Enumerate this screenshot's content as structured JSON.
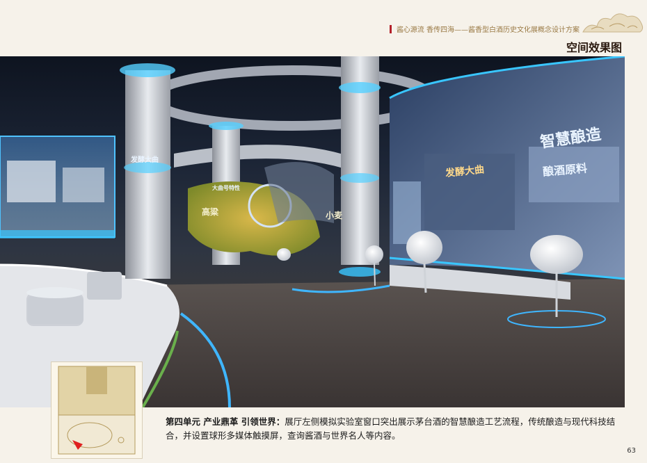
{
  "header": {
    "subtitle": "酱心源流 香传四海——酱香型白酒历史文化展概念设计方案",
    "section_title": "空间效果图"
  },
  "hero": {
    "signs": {
      "smart_brewing": "智慧酿造",
      "brewing_materials": "酿酒原料",
      "fermentation": "发酵大曲",
      "pillar_left": "发酵大曲",
      "pillar_mid": "大曲号特性",
      "sorghum": "高粱",
      "wheat": "小麦"
    }
  },
  "caption": {
    "heading": "第四单元  产业鼎革  引领世界：",
    "body": "展厅左侧模拟实验室窗口突出展示茅台酒的智慧酿造工艺流程，传统酿造与现代科技结合，并设置球形多媒体触摸屏，查询酱酒与世界名人等内容。"
  },
  "page_number": "63",
  "colors": {
    "accent_red": "#b4202a",
    "gold": "#9a7a45",
    "glow_blue": "#39c6ff"
  }
}
